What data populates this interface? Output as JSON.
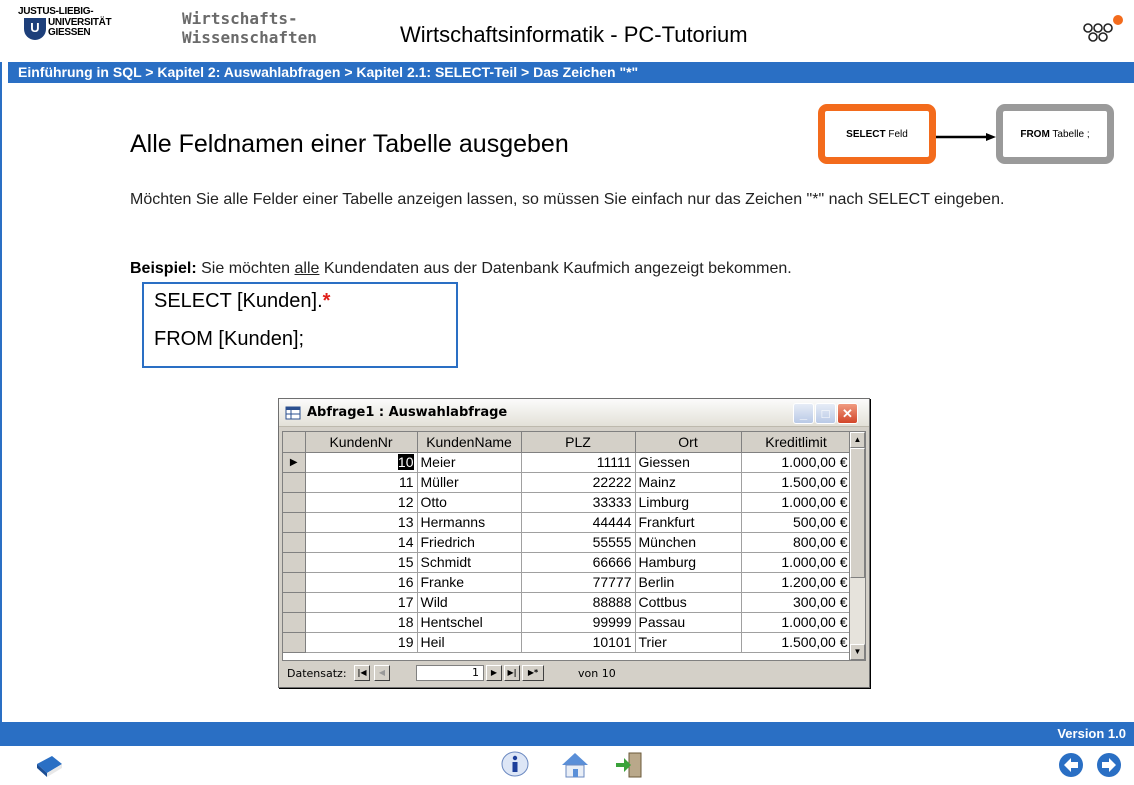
{
  "header": {
    "university_line1": "JUSTUS-LIEBIG-",
    "university_line2": "UNIVERSITÄT",
    "university_line3": "GIESSEN",
    "faculty_line1": "Wirtschafts-",
    "faculty_line2": "Wissenschaften",
    "title": "Wirtschaftsinformatik - PC-Tutorium"
  },
  "breadcrumb": "Einführung in SQL > Kapitel 2: Auswahlabfragen > Kapitel 2.1: SELECT-Teil > Das Zeichen \"*\"",
  "content": {
    "title": "Alle Feldnamen einer Tabelle ausgeben",
    "paragraph": "Möchten Sie alle Felder einer Tabelle anzeigen lassen, so müssen Sie einfach nur das Zeichen \"*\" nach SELECT eingeben.",
    "example_label": "Beispiel:",
    "example_text_pre": " Sie möchten ",
    "example_text_underlined": "alle",
    "example_text_post": " Kundendaten aus der Datenbank Kaufmich angezeigt bekommen.",
    "sql_line1_prefix": "SELECT [Kunden].",
    "sql_line1_star": "*",
    "sql_line2": "FROM [Kunden];"
  },
  "diagram": {
    "select_keyword": "SELECT",
    "select_rest": " Feld",
    "from_keyword": "FROM",
    "from_rest": " Tabelle ;",
    "select_color": "#f36b1c",
    "from_color": "#9a9a9a"
  },
  "window": {
    "title": "Abfrage1 : Auswahlabfrage",
    "columns": [
      "KundenNr",
      "KundenName",
      "PLZ",
      "Ort",
      "Kreditlimit"
    ],
    "rows": [
      {
        "nr": "10",
        "name": "Meier",
        "plz": "11111",
        "ort": "Giessen",
        "limit": "1.000,00 €"
      },
      {
        "nr": "11",
        "name": "Müller",
        "plz": "22222",
        "ort": "Mainz",
        "limit": "1.500,00 €"
      },
      {
        "nr": "12",
        "name": "Otto",
        "plz": "33333",
        "ort": "Limburg",
        "limit": "1.000,00 €"
      },
      {
        "nr": "13",
        "name": "Hermanns",
        "plz": "44444",
        "ort": "Frankfurt",
        "limit": "500,00 €"
      },
      {
        "nr": "14",
        "name": "Friedrich",
        "plz": "55555",
        "ort": "München",
        "limit": "800,00 €"
      },
      {
        "nr": "15",
        "name": "Schmidt",
        "plz": "66666",
        "ort": "Hamburg",
        "limit": "1.000,00 €"
      },
      {
        "nr": "16",
        "name": "Franke",
        "plz": "77777",
        "ort": "Berlin",
        "limit": "1.200,00 €"
      },
      {
        "nr": "17",
        "name": "Wild",
        "plz": "88888",
        "ort": "Cottbus",
        "limit": "300,00 €"
      },
      {
        "nr": "18",
        "name": "Hentschel",
        "plz": "99999",
        "ort": "Passau",
        "limit": "1.000,00 €"
      },
      {
        "nr": "19",
        "name": "Heil",
        "plz": "10101",
        "ort": "Trier",
        "limit": "1.500,00 €"
      }
    ],
    "nav_label": "Datensatz:",
    "nav_current": "1",
    "nav_of": "von 10"
  },
  "footer": {
    "version": "Version 1.0"
  },
  "colors": {
    "accent_blue": "#2a6fc4",
    "orange": "#f36b1c"
  }
}
